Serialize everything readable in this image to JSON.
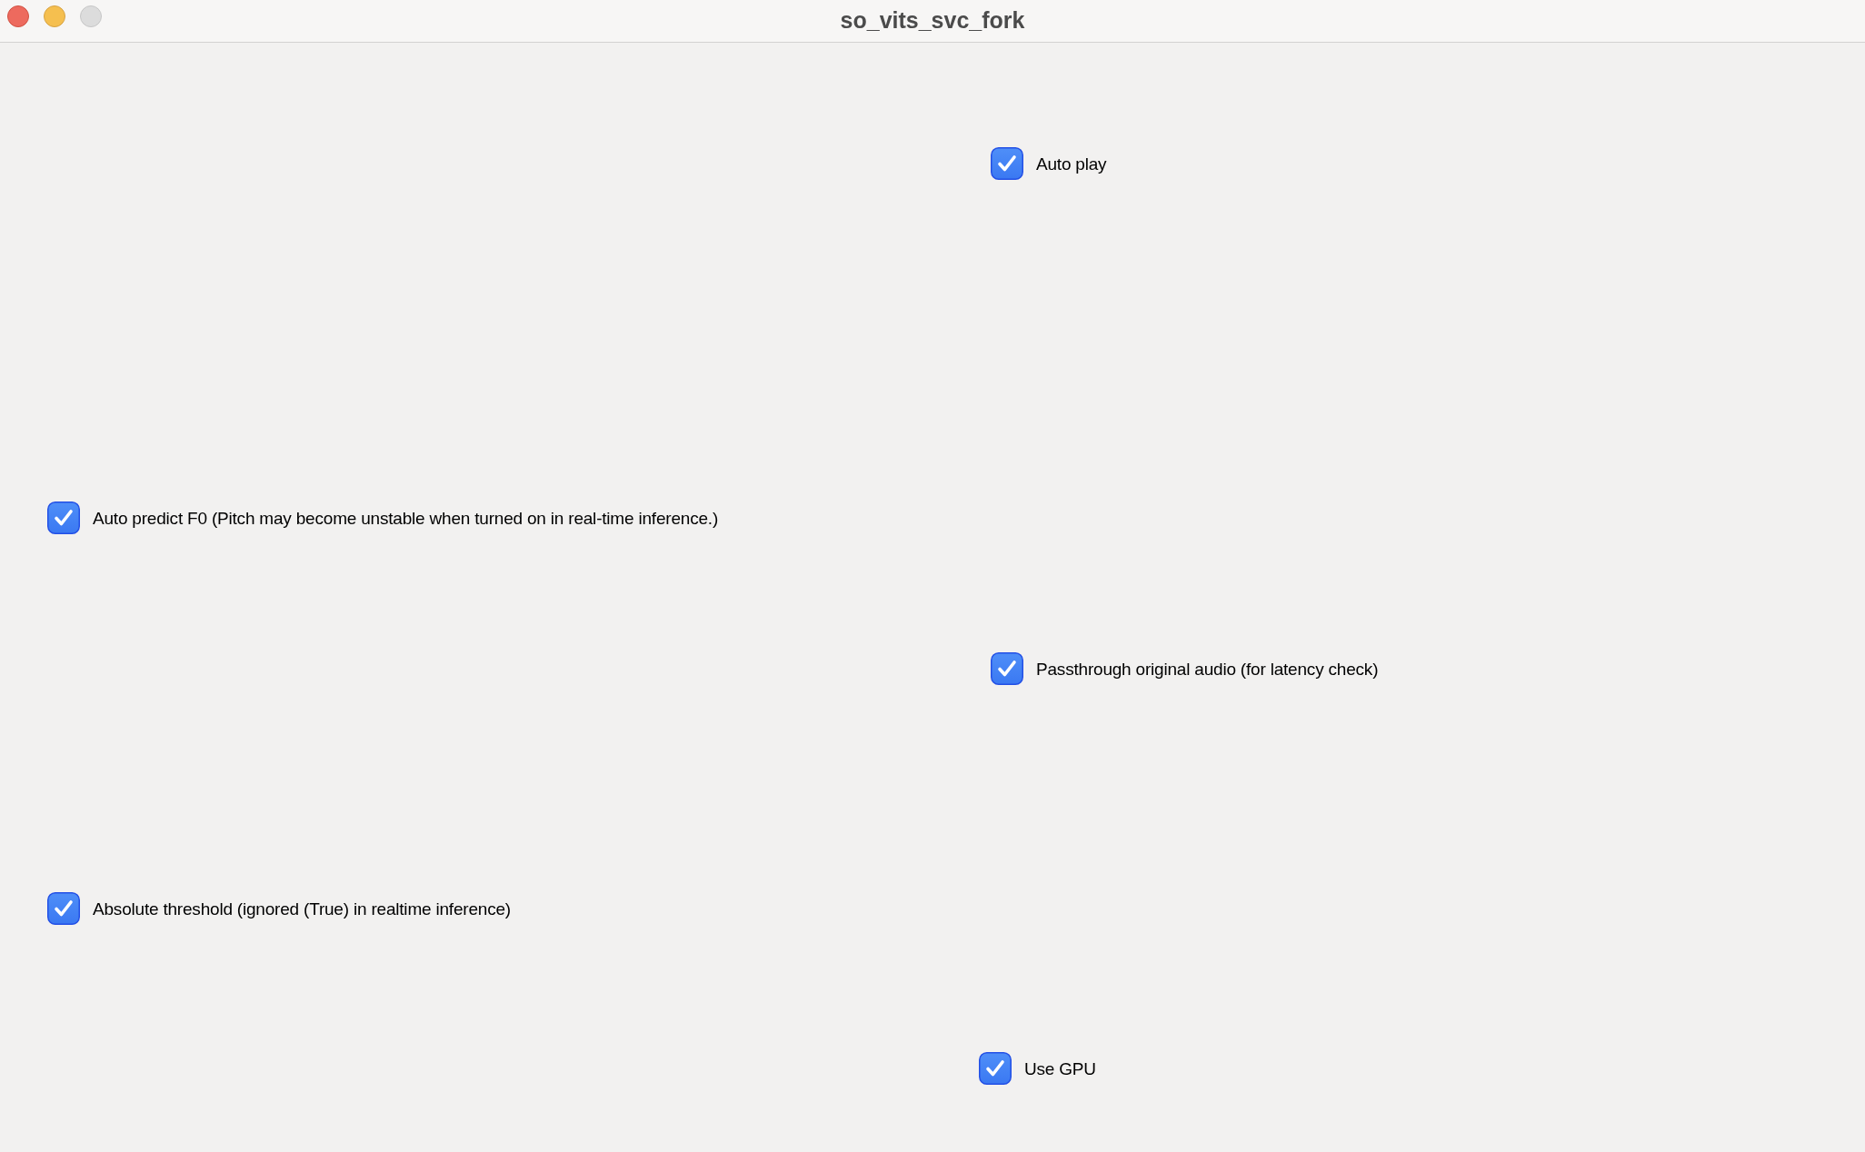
{
  "window": {
    "title": "so_vits_svc_fork",
    "buttons": [
      {
        "kind": "close",
        "disabled": false
      },
      {
        "kind": "minimize",
        "disabled": false
      },
      {
        "kind": "zoom",
        "disabled": true
      }
    ]
  },
  "options": [
    {
      "label": "Auto play",
      "checked": true
    },
    {
      "label": "Auto predict F0 (Pitch may become unstable when turned on in real-time inference.)",
      "checked": true
    },
    {
      "label": "Passthrough original audio (for latency check)",
      "checked": true
    },
    {
      "label": "Absolute threshold (ignored (True) in realtime inference)",
      "checked": true
    },
    {
      "label": "Use GPU",
      "checked": true
    }
  ]
}
